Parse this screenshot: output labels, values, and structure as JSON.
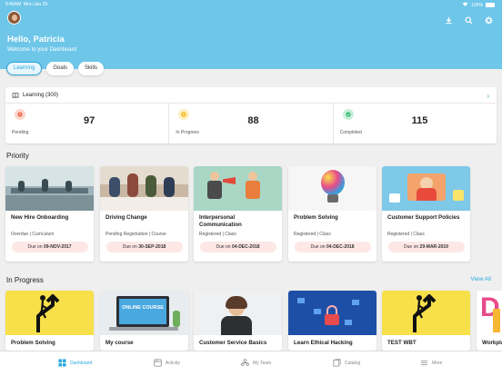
{
  "status": {
    "time": "9:45AM",
    "date": "Mon Jan 29",
    "battery": "100%"
  },
  "header": {
    "greeting": "Hello, Patricia",
    "subtitle": "Welcome to your Dashboard",
    "tabs": [
      {
        "label": "Learning",
        "active": true
      },
      {
        "label": "Goals",
        "active": false
      },
      {
        "label": "Skills",
        "active": false
      }
    ],
    "icons": [
      "download-icon",
      "search-icon",
      "gear-icon"
    ]
  },
  "learning": {
    "title": "Learning (300)",
    "stats": [
      {
        "label": "Pending",
        "value": "97",
        "color": "#f06a4e"
      },
      {
        "label": "In Progress",
        "value": "88",
        "color": "#f4b400"
      },
      {
        "label": "Completed",
        "value": "115",
        "color": "#2eb872"
      }
    ]
  },
  "priority": {
    "title": "Priority",
    "cards": [
      {
        "title": "New Hire Onboarding",
        "meta": "Overdue | Curriculum",
        "due_prefix": "Due on",
        "due_date": "09-NOV-2017"
      },
      {
        "title": "Driving Change",
        "meta": "Pending Registration | Course",
        "due_prefix": "Due on",
        "due_date": "30-SEP-2018"
      },
      {
        "title": "Interpersonal Communication",
        "meta": "Registered | Class",
        "due_prefix": "Due on",
        "due_date": "04-DEC-2018"
      },
      {
        "title": "Problem Solving",
        "meta": "Registered | Class",
        "due_prefix": "Due on",
        "due_date": "04-DEC-2018"
      },
      {
        "title": "Customer Support Policies",
        "meta": "Registered | Class",
        "due_prefix": "Due on",
        "due_date": "29-MAR-2019"
      }
    ]
  },
  "in_progress": {
    "title": "In Progress",
    "view_all": "View All",
    "cards": [
      {
        "title": "Problem Solving"
      },
      {
        "title": "My course",
        "image_text": "ONLINE COURSE"
      },
      {
        "title": "Customer Service Basics"
      },
      {
        "title": "Learn Ethical Hacking"
      },
      {
        "title": "TEST WBT"
      },
      {
        "title": "Workpla",
        "image_text": "D"
      }
    ]
  },
  "tabbar": [
    {
      "label": "Dashboard",
      "icon": "dashboard-icon",
      "active": true
    },
    {
      "label": "Activity",
      "icon": "activity-icon",
      "active": false
    },
    {
      "label": "My Team",
      "icon": "team-icon",
      "active": false
    },
    {
      "label": "Catalog",
      "icon": "catalog-icon",
      "active": false
    },
    {
      "label": "More",
      "icon": "more-icon",
      "active": false
    }
  ],
  "colors": {
    "header": "#6ec6e9",
    "accent": "#2aa9dd",
    "due_bg": "#fde8e6"
  }
}
